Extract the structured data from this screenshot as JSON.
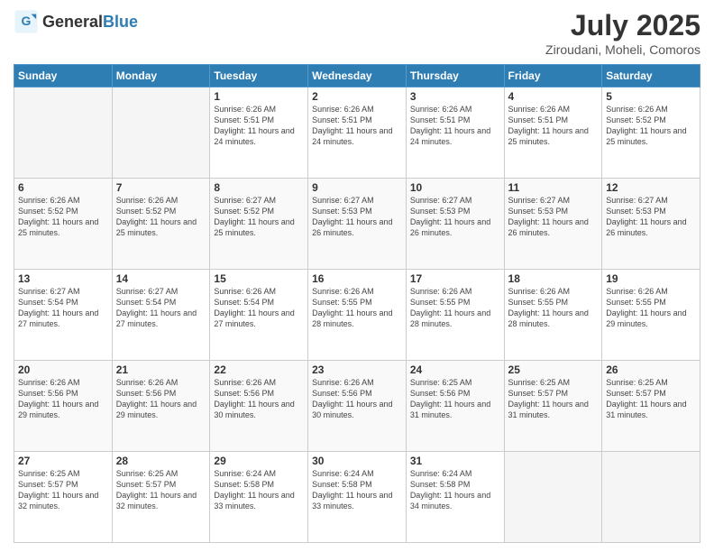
{
  "header": {
    "logo_general": "General",
    "logo_blue": "Blue",
    "title": "July 2025",
    "location": "Ziroudani, Moheli, Comoros"
  },
  "weekdays": [
    "Sunday",
    "Monday",
    "Tuesday",
    "Wednesday",
    "Thursday",
    "Friday",
    "Saturday"
  ],
  "weeks": [
    [
      {
        "day": "",
        "sunrise": "",
        "sunset": "",
        "daylight": ""
      },
      {
        "day": "",
        "sunrise": "",
        "sunset": "",
        "daylight": ""
      },
      {
        "day": "1",
        "sunrise": "Sunrise: 6:26 AM",
        "sunset": "Sunset: 5:51 PM",
        "daylight": "Daylight: 11 hours and 24 minutes."
      },
      {
        "day": "2",
        "sunrise": "Sunrise: 6:26 AM",
        "sunset": "Sunset: 5:51 PM",
        "daylight": "Daylight: 11 hours and 24 minutes."
      },
      {
        "day": "3",
        "sunrise": "Sunrise: 6:26 AM",
        "sunset": "Sunset: 5:51 PM",
        "daylight": "Daylight: 11 hours and 24 minutes."
      },
      {
        "day": "4",
        "sunrise": "Sunrise: 6:26 AM",
        "sunset": "Sunset: 5:51 PM",
        "daylight": "Daylight: 11 hours and 25 minutes."
      },
      {
        "day": "5",
        "sunrise": "Sunrise: 6:26 AM",
        "sunset": "Sunset: 5:52 PM",
        "daylight": "Daylight: 11 hours and 25 minutes."
      }
    ],
    [
      {
        "day": "6",
        "sunrise": "Sunrise: 6:26 AM",
        "sunset": "Sunset: 5:52 PM",
        "daylight": "Daylight: 11 hours and 25 minutes."
      },
      {
        "day": "7",
        "sunrise": "Sunrise: 6:26 AM",
        "sunset": "Sunset: 5:52 PM",
        "daylight": "Daylight: 11 hours and 25 minutes."
      },
      {
        "day": "8",
        "sunrise": "Sunrise: 6:27 AM",
        "sunset": "Sunset: 5:52 PM",
        "daylight": "Daylight: 11 hours and 25 minutes."
      },
      {
        "day": "9",
        "sunrise": "Sunrise: 6:27 AM",
        "sunset": "Sunset: 5:53 PM",
        "daylight": "Daylight: 11 hours and 26 minutes."
      },
      {
        "day": "10",
        "sunrise": "Sunrise: 6:27 AM",
        "sunset": "Sunset: 5:53 PM",
        "daylight": "Daylight: 11 hours and 26 minutes."
      },
      {
        "day": "11",
        "sunrise": "Sunrise: 6:27 AM",
        "sunset": "Sunset: 5:53 PM",
        "daylight": "Daylight: 11 hours and 26 minutes."
      },
      {
        "day": "12",
        "sunrise": "Sunrise: 6:27 AM",
        "sunset": "Sunset: 5:53 PM",
        "daylight": "Daylight: 11 hours and 26 minutes."
      }
    ],
    [
      {
        "day": "13",
        "sunrise": "Sunrise: 6:27 AM",
        "sunset": "Sunset: 5:54 PM",
        "daylight": "Daylight: 11 hours and 27 minutes."
      },
      {
        "day": "14",
        "sunrise": "Sunrise: 6:27 AM",
        "sunset": "Sunset: 5:54 PM",
        "daylight": "Daylight: 11 hours and 27 minutes."
      },
      {
        "day": "15",
        "sunrise": "Sunrise: 6:26 AM",
        "sunset": "Sunset: 5:54 PM",
        "daylight": "Daylight: 11 hours and 27 minutes."
      },
      {
        "day": "16",
        "sunrise": "Sunrise: 6:26 AM",
        "sunset": "Sunset: 5:55 PM",
        "daylight": "Daylight: 11 hours and 28 minutes."
      },
      {
        "day": "17",
        "sunrise": "Sunrise: 6:26 AM",
        "sunset": "Sunset: 5:55 PM",
        "daylight": "Daylight: 11 hours and 28 minutes."
      },
      {
        "day": "18",
        "sunrise": "Sunrise: 6:26 AM",
        "sunset": "Sunset: 5:55 PM",
        "daylight": "Daylight: 11 hours and 28 minutes."
      },
      {
        "day": "19",
        "sunrise": "Sunrise: 6:26 AM",
        "sunset": "Sunset: 5:55 PM",
        "daylight": "Daylight: 11 hours and 29 minutes."
      }
    ],
    [
      {
        "day": "20",
        "sunrise": "Sunrise: 6:26 AM",
        "sunset": "Sunset: 5:56 PM",
        "daylight": "Daylight: 11 hours and 29 minutes."
      },
      {
        "day": "21",
        "sunrise": "Sunrise: 6:26 AM",
        "sunset": "Sunset: 5:56 PM",
        "daylight": "Daylight: 11 hours and 29 minutes."
      },
      {
        "day": "22",
        "sunrise": "Sunrise: 6:26 AM",
        "sunset": "Sunset: 5:56 PM",
        "daylight": "Daylight: 11 hours and 30 minutes."
      },
      {
        "day": "23",
        "sunrise": "Sunrise: 6:26 AM",
        "sunset": "Sunset: 5:56 PM",
        "daylight": "Daylight: 11 hours and 30 minutes."
      },
      {
        "day": "24",
        "sunrise": "Sunrise: 6:25 AM",
        "sunset": "Sunset: 5:56 PM",
        "daylight": "Daylight: 11 hours and 31 minutes."
      },
      {
        "day": "25",
        "sunrise": "Sunrise: 6:25 AM",
        "sunset": "Sunset: 5:57 PM",
        "daylight": "Daylight: 11 hours and 31 minutes."
      },
      {
        "day": "26",
        "sunrise": "Sunrise: 6:25 AM",
        "sunset": "Sunset: 5:57 PM",
        "daylight": "Daylight: 11 hours and 31 minutes."
      }
    ],
    [
      {
        "day": "27",
        "sunrise": "Sunrise: 6:25 AM",
        "sunset": "Sunset: 5:57 PM",
        "daylight": "Daylight: 11 hours and 32 minutes."
      },
      {
        "day": "28",
        "sunrise": "Sunrise: 6:25 AM",
        "sunset": "Sunset: 5:57 PM",
        "daylight": "Daylight: 11 hours and 32 minutes."
      },
      {
        "day": "29",
        "sunrise": "Sunrise: 6:24 AM",
        "sunset": "Sunset: 5:58 PM",
        "daylight": "Daylight: 11 hours and 33 minutes."
      },
      {
        "day": "30",
        "sunrise": "Sunrise: 6:24 AM",
        "sunset": "Sunset: 5:58 PM",
        "daylight": "Daylight: 11 hours and 33 minutes."
      },
      {
        "day": "31",
        "sunrise": "Sunrise: 6:24 AM",
        "sunset": "Sunset: 5:58 PM",
        "daylight": "Daylight: 11 hours and 34 minutes."
      },
      {
        "day": "",
        "sunrise": "",
        "sunset": "",
        "daylight": ""
      },
      {
        "day": "",
        "sunrise": "",
        "sunset": "",
        "daylight": ""
      }
    ]
  ]
}
